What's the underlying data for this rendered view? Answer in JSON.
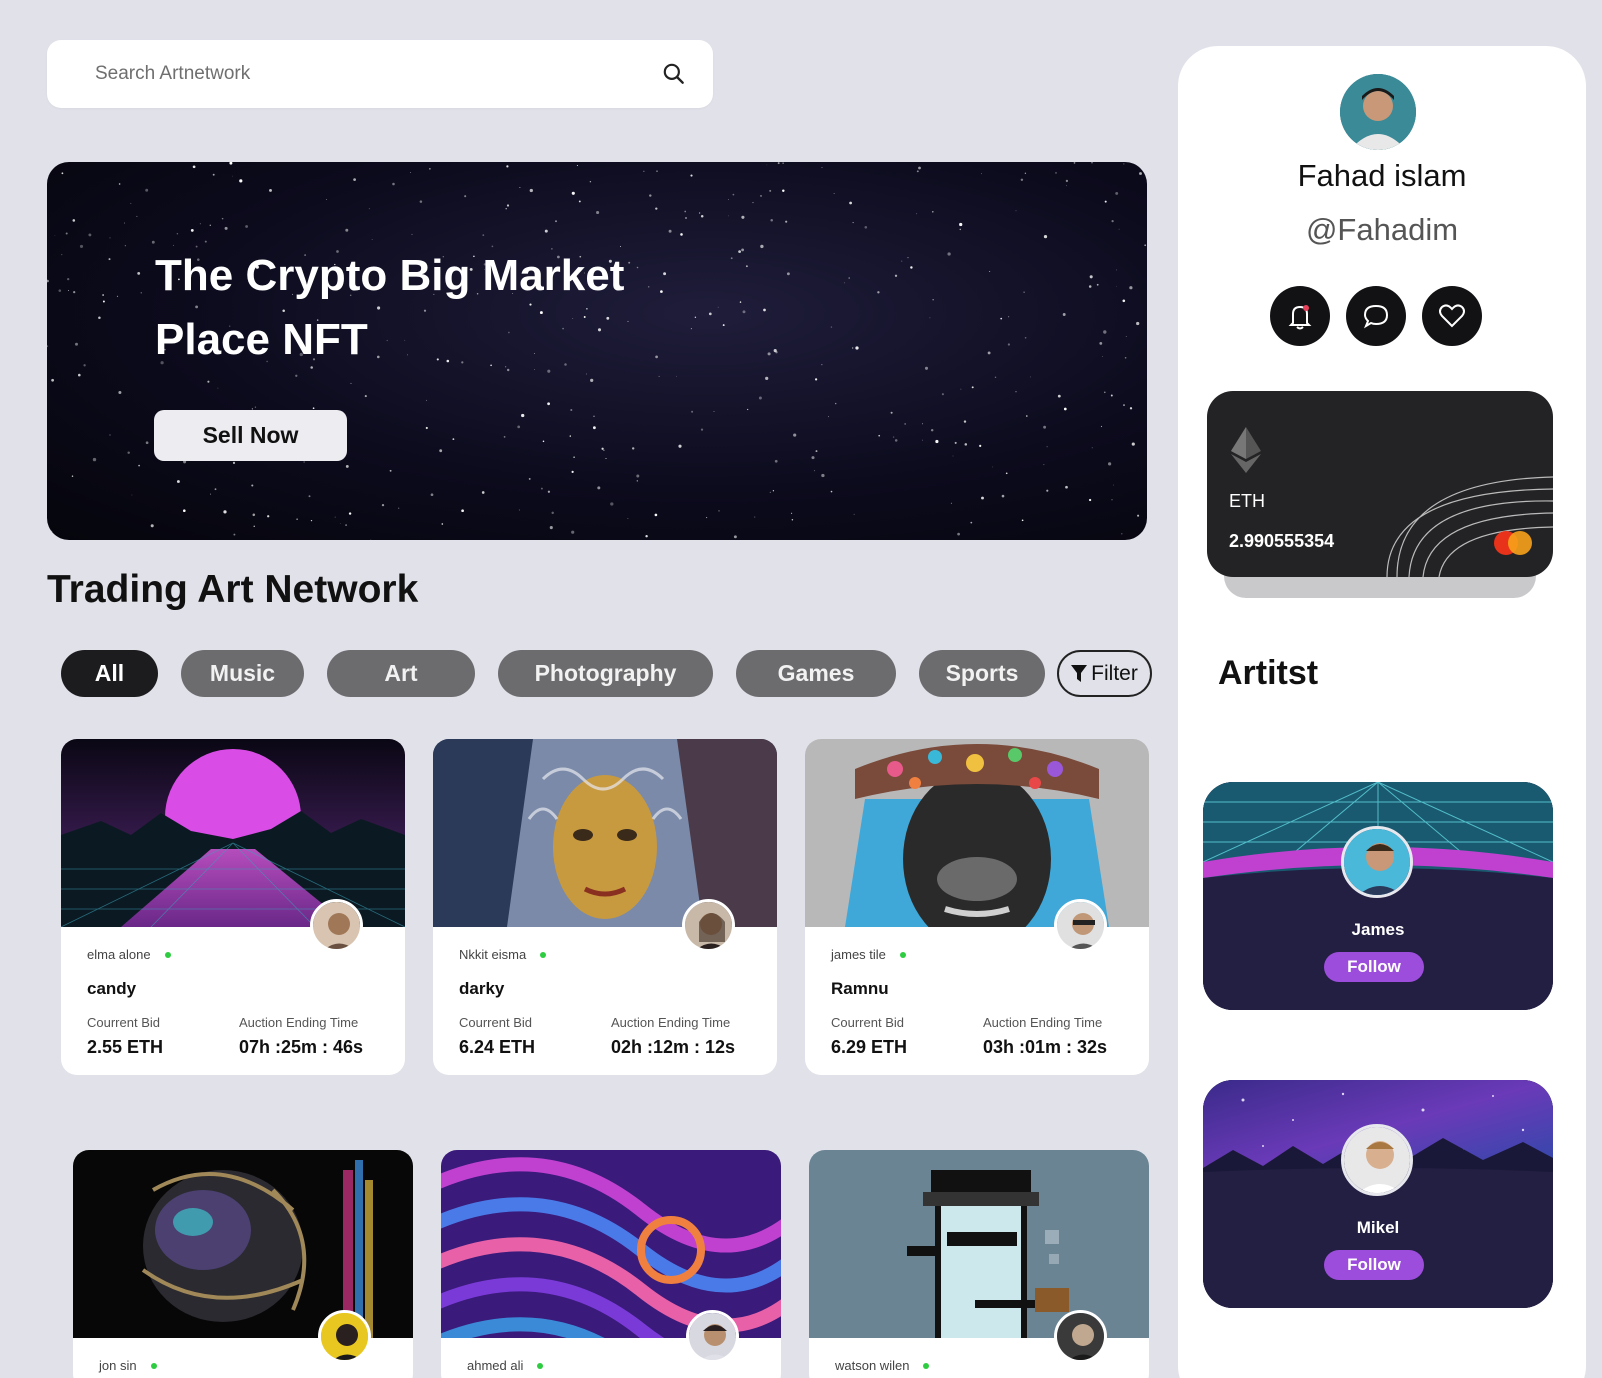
{
  "search": {
    "placeholder": "Search Artnetwork",
    "icon": "search-icon"
  },
  "hero": {
    "title": "The Crypto Big Market Place NFT",
    "button": "Sell Now"
  },
  "section_title": "Trading Art Network",
  "tabs": [
    "All",
    "Music",
    "Art",
    "Photography",
    "Games",
    "Sports"
  ],
  "filter_label": "Filter",
  "cards": [
    {
      "creator": "elma alone",
      "name": "candy",
      "bid_label": "Courrent Bid",
      "bid": "2.55 ETH",
      "time_label": "Auction Ending Time",
      "time": "07h :25m : 46s"
    },
    {
      "creator": "Nkkit eisma",
      "name": "darky",
      "bid_label": "Courrent Bid",
      "bid": "6.24 ETH",
      "time_label": "Auction Ending Time",
      "time": "02h :12m : 12s"
    },
    {
      "creator": "james tile",
      "name": "Ramnu",
      "bid_label": "Courrent Bid",
      "bid": "6.29 ETH",
      "time_label": "Auction Ending Time",
      "time": "03h :01m : 32s"
    },
    {
      "creator": "jon sin"
    },
    {
      "creator": "ahmed ali"
    },
    {
      "creator": "watson wilen"
    }
  ],
  "profile": {
    "name": "Fahad islam",
    "handle": "@Fahadim"
  },
  "wallet": {
    "currency": "ETH",
    "amount": "2.990555354"
  },
  "artists_title": "Artitst",
  "artists": [
    {
      "name": "James",
      "button": "Follow"
    },
    {
      "name": "Mikel",
      "button": "Follow"
    }
  ],
  "colors": {
    "background": "#e1e1ea",
    "tab": "#6c6c6f",
    "tab_active": "#1c1c1f",
    "follow": "#9c4ddb",
    "online": "#2ecc40"
  }
}
